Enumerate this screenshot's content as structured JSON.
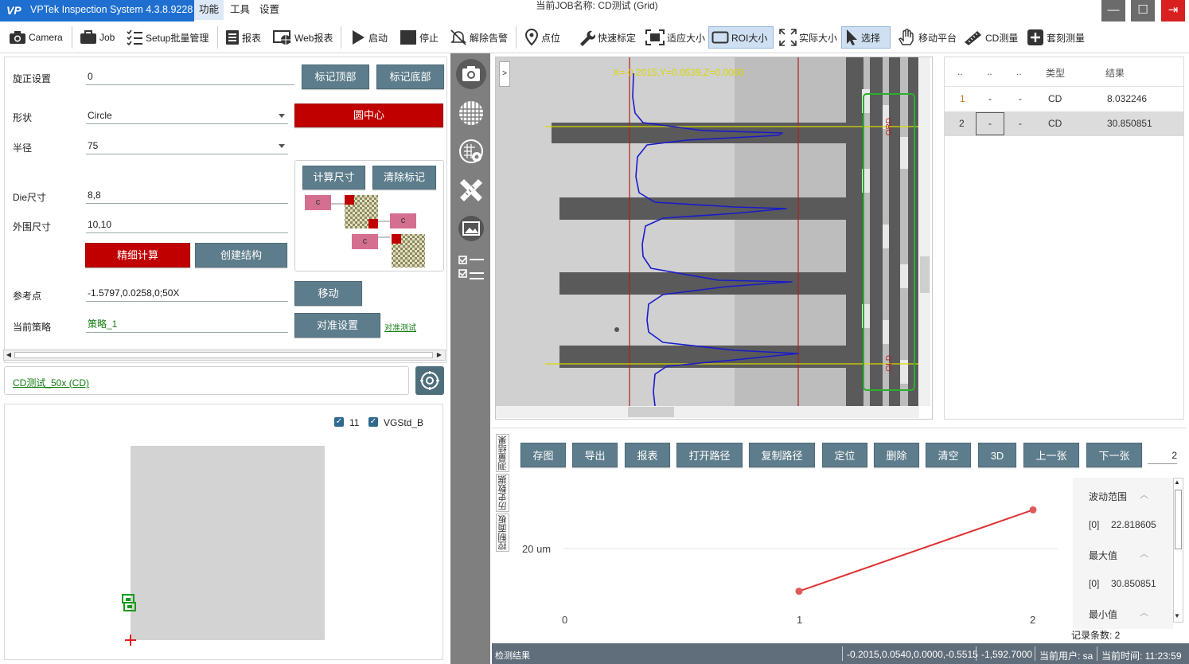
{
  "window": {
    "app_title": "VPTek Inspection System 4.3.8.9228",
    "logo": "VP",
    "job_title": "当前JOB名称:  CD测试 (Grid)"
  },
  "menu": {
    "items": [
      "功能",
      "工具",
      "设置"
    ]
  },
  "window_controls": {
    "minimize": "—",
    "maximize": "☐",
    "exit": "⇥"
  },
  "toolbar": {
    "items": [
      "Camera",
      "Job",
      "Setup批量管理",
      "报表",
      "Web报表",
      "启动",
      "停止",
      "解除告警",
      "点位",
      "快速标定",
      "适应大小",
      "ROI大小",
      "实际大小",
      "选择",
      "移动平台",
      "CD测量",
      "套刻测量"
    ]
  },
  "left": {
    "rotate_label": "旋正设置",
    "rotate_value": "0",
    "mark_top": "标记顶部",
    "mark_bottom": "标记底部",
    "shape_label": "形状",
    "shape_value": "Circle",
    "circle_center": "圆中心",
    "radius_label": "半径",
    "radius_value": "75",
    "calc_size": "计算尺寸",
    "clear_marks": "清除标记",
    "die_label": "Die尺寸",
    "die_value": "8,8",
    "outer_label": "外围尺寸",
    "outer_value": "10,10",
    "fine_calc": "精细计算",
    "create_struct": "创建结构",
    "ref_label": "参考点",
    "ref_value": "-1.5797,0.0258,0;50X",
    "move": "移动",
    "strategy_label": "当前策略",
    "strategy_value": "策略_1",
    "align_settings": "对准设置",
    "align_test": "对准测试",
    "diagram_c": "c"
  },
  "recipe": {
    "link": "CD测试_50x (CD)"
  },
  "map": {
    "check1_label": "11",
    "check2_label": "VGStd_B"
  },
  "viewer": {
    "expand": ">",
    "overlay_text": "X=-0.2015,Y=0.0539,Z=0.0000",
    "mark_top": "ORD",
    "mark_bottom": "OLD"
  },
  "results": {
    "headers": [
      "..",
      "..",
      "..",
      "类型",
      "结果"
    ],
    "rows": [
      [
        "1",
        "-",
        "-",
        "CD",
        "8.032246"
      ],
      [
        "2",
        "-",
        "-",
        "CD",
        "30.850851"
      ]
    ]
  },
  "bottom": {
    "buttons": [
      "存图",
      "导出",
      "报表",
      "打开路径",
      "复制路径",
      "定位",
      "删除",
      "清空",
      "3D",
      "上一张",
      "下一张"
    ],
    "page_value": "2",
    "tabs": [
      "测量结果",
      "历史数据",
      "控制面板"
    ]
  },
  "trend": {
    "y_label": "20 um",
    "x_ticks": [
      "0",
      "1",
      "2"
    ]
  },
  "stats": {
    "range_label": "波动范围",
    "range_value": "22.818605",
    "max_label": "最大值",
    "max_value": "30.850851",
    "min_label": "最小值",
    "index": "[0]",
    "count": "记录条数: 2"
  },
  "chart_data": {
    "type": "line",
    "x": [
      1,
      2
    ],
    "values": [
      8.032246,
      30.850851
    ],
    "xlabel": "",
    "ylabel": "",
    "xlim": [
      0,
      2
    ],
    "y_tick_labels": [
      "20 um"
    ],
    "series": [
      {
        "values": [
          8.032246,
          30.850851
        ]
      }
    ]
  },
  "status": {
    "left": "检测结果",
    "coords": "-0.2015,0.0540,0.0000,-0.5515",
    "z": "-1,592.7000",
    "user": "当前用户: sa",
    "time": "当前时间: 11:23:59"
  },
  "colors": {
    "accent": "#1e6fd0",
    "button": "#5e7d8c",
    "red_button": "#c00000",
    "trace": "#1a1acc",
    "roi": "#2bb02b"
  }
}
